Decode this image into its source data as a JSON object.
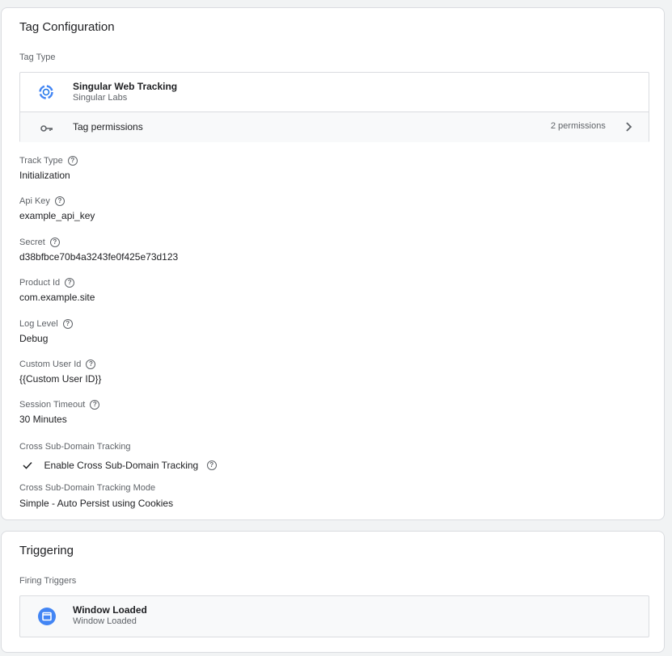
{
  "tag_config": {
    "title": "Tag Configuration",
    "tag_type_label": "Tag Type",
    "tag_name": "Singular Web Tracking",
    "tag_vendor": "Singular Labs",
    "permissions_label": "Tag permissions",
    "permissions_count": "2 permissions",
    "fields": [
      {
        "label": "Track Type",
        "value": "Initialization"
      },
      {
        "label": "Api Key",
        "value": "example_api_key"
      },
      {
        "label": "Secret",
        "value": "d38bfbce70b4a3243fe0f425e73d123"
      },
      {
        "label": "Product Id",
        "value": "com.example.site"
      },
      {
        "label": "Log Level",
        "value": "Debug"
      },
      {
        "label": "Custom User Id",
        "value": "{{Custom User ID}}"
      },
      {
        "label": "Session Timeout",
        "value": "30 Minutes"
      }
    ],
    "cross_domain": {
      "label": "Cross Sub-Domain Tracking",
      "checkbox_label": "Enable Cross Sub-Domain Tracking",
      "checked": true
    },
    "mode": {
      "label": "Cross Sub-Domain Tracking Mode",
      "value": "Simple - Auto Persist using Cookies"
    }
  },
  "triggering": {
    "title": "Triggering",
    "firing_label": "Firing Triggers",
    "trigger_name": "Window Loaded",
    "trigger_type": "Window Loaded"
  },
  "icons": {
    "tag_icon": "singular-logo-icon",
    "key_icon": "key-icon",
    "chevron_icon": "chevron-right-icon",
    "help_icon": "help-circle-icon",
    "check_icon": "check-icon",
    "trigger_icon": "window-icon"
  },
  "colors": {
    "accent_blue": "#4285f4",
    "trigger_blue": "#1a73e8"
  }
}
